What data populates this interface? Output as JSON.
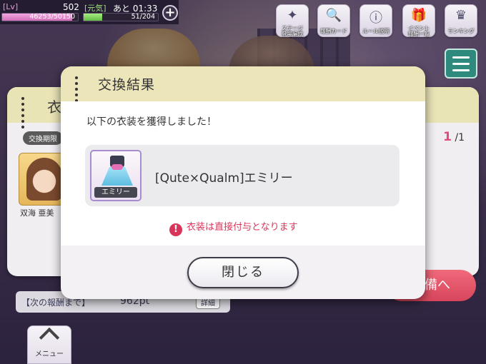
{
  "status": {
    "lv_tag": "[Lv]",
    "lv_value": "502",
    "genki_tag": "[元気]",
    "remaining": "あと 01:33",
    "lv_exp": "46253/50150",
    "genki_value": "51/204",
    "lv_fill": 0.92,
    "genki_fill": 0.25
  },
  "toolbar": [
    {
      "label": "ステージ\n登場編成",
      "icon": "stage-icon"
    },
    {
      "label": "報酬カード",
      "icon": "reward-card-icon"
    },
    {
      "label": "ルール説明",
      "icon": "info-icon"
    },
    {
      "label": "イベント\n報酬一覧",
      "icon": "gift-icon"
    },
    {
      "label": "ランキング",
      "icon": "ranking-icon"
    }
  ],
  "back_panel": {
    "title": "衣",
    "chip": "交換期限",
    "card_name": "双海 亜美",
    "page_current": "1",
    "page_total": "/1"
  },
  "below": {
    "next_reward_label": "【次の報酬まで】",
    "next_reward_value": "962pt",
    "detail_button": "詳細",
    "right_button": "準備へ",
    "menu_label": "メニュー"
  },
  "modal": {
    "title": "交換結果",
    "message": "以下の衣装を獲得しました！",
    "item_label": "エミリー",
    "item_name": "[Qute×Qualm]エミリー",
    "warning": "衣装は直接付与となります",
    "close_label": "閉じる"
  },
  "colors": {
    "accent_pink": "#d9345a",
    "header_yellow": "#ebe5b9",
    "menu_teal": "#2f8a7e"
  }
}
